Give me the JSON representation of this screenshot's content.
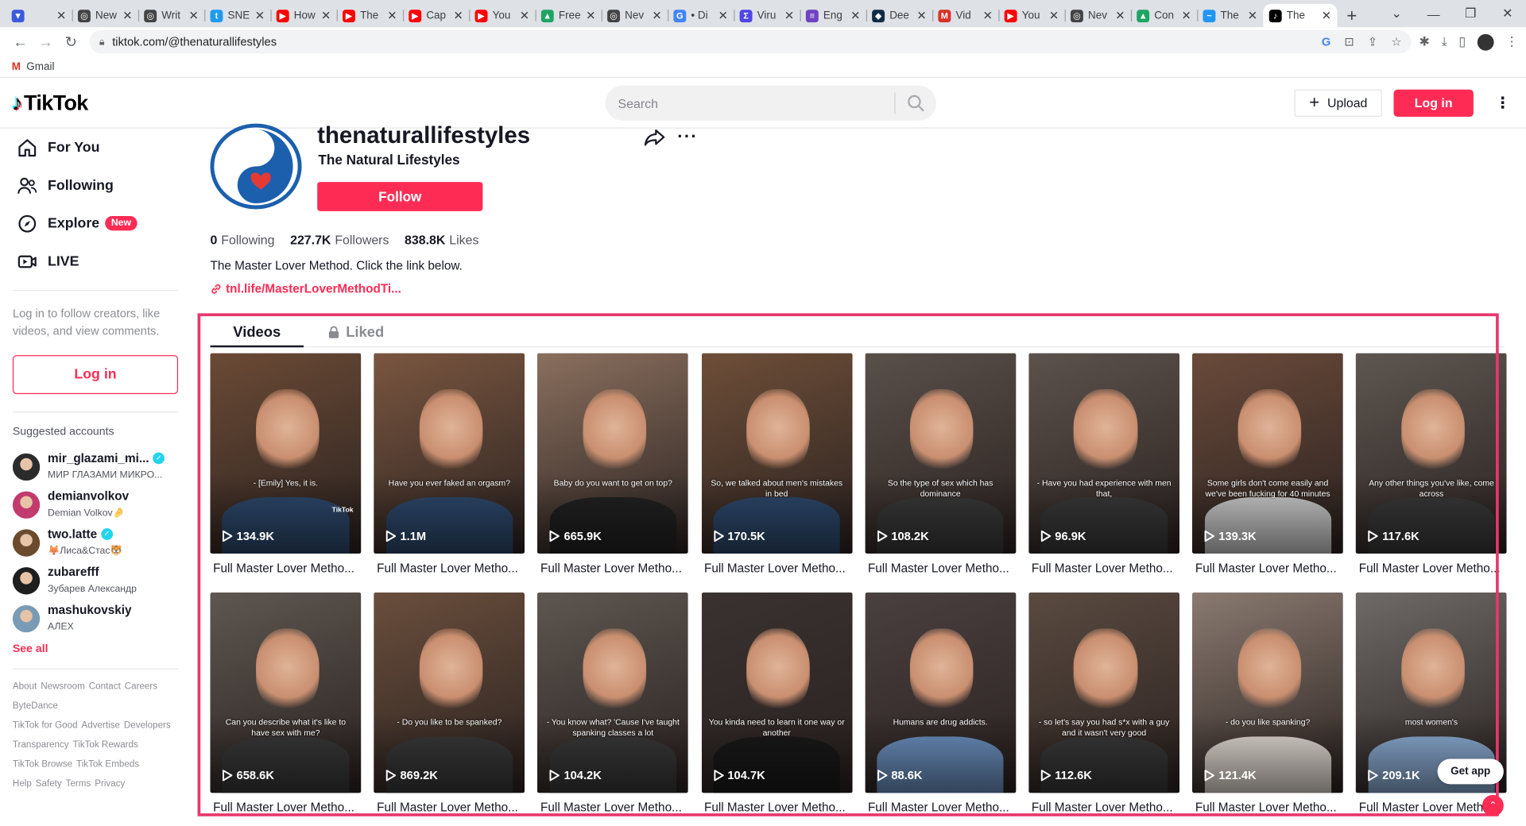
{
  "browser": {
    "tabs": [
      {
        "label": "",
        "icon": "vee-icon",
        "color": "#3b5bdb",
        "glyph": "▼"
      },
      {
        "label": "New",
        "icon": "chatgpt-icon",
        "color": "#444",
        "glyph": "◎"
      },
      {
        "label": "Writ",
        "icon": "chatgpt-icon",
        "color": "#444",
        "glyph": "◎"
      },
      {
        "label": "SNE",
        "icon": "twitter-icon",
        "color": "#1d9bf0",
        "glyph": "t"
      },
      {
        "label": "How",
        "icon": "youtube-icon",
        "color": "#ff0000",
        "glyph": "▶"
      },
      {
        "label": "The",
        "icon": "youtube-icon",
        "color": "#ff0000",
        "glyph": "▶"
      },
      {
        "label": "Cap",
        "icon": "youtube-icon",
        "color": "#ff0000",
        "glyph": "▶"
      },
      {
        "label": "You",
        "icon": "youtube-icon",
        "color": "#ff0000",
        "glyph": "▶"
      },
      {
        "label": "Free",
        "icon": "drive-icon",
        "color": "#1fa463",
        "glyph": "▲"
      },
      {
        "label": "Nev",
        "icon": "chatgpt-icon",
        "color": "#444",
        "glyph": "◎"
      },
      {
        "label": "• Di",
        "icon": "google-icon",
        "color": "#4285f4",
        "glyph": "G"
      },
      {
        "label": "Viru",
        "icon": "sigma-icon",
        "color": "#5046e5",
        "glyph": "Σ"
      },
      {
        "label": "Eng",
        "icon": "docs-icon",
        "color": "#6f42c1",
        "glyph": "≡"
      },
      {
        "label": "Dee",
        "icon": "deepl-icon",
        "color": "#0f2b46",
        "glyph": "◆"
      },
      {
        "label": "Vid",
        "icon": "gmail-icon",
        "color": "#d93025",
        "glyph": "M"
      },
      {
        "label": "You",
        "icon": "youtube-icon",
        "color": "#ff0000",
        "glyph": "▶"
      },
      {
        "label": "Nev",
        "icon": "chatgpt-icon",
        "color": "#444",
        "glyph": "◎"
      },
      {
        "label": "Con",
        "icon": "drive-icon",
        "color": "#1fa463",
        "glyph": "▲"
      },
      {
        "label": "The",
        "icon": "bird-icon",
        "color": "#2196f3",
        "glyph": "~"
      },
      {
        "label": "The",
        "icon": "tiktok-icon",
        "color": "#000",
        "glyph": "♪",
        "active": true
      }
    ],
    "url": "tiktok.com/@thenaturallifestyles",
    "bookmark": "Gmail"
  },
  "header": {
    "logo": "TikTok",
    "search_placeholder": "Search",
    "upload": "Upload",
    "login": "Log in"
  },
  "sidebar": {
    "nav": [
      {
        "label": "For You",
        "icon": "home-icon"
      },
      {
        "label": "Following",
        "icon": "following-icon"
      },
      {
        "label": "Explore",
        "icon": "compass-icon",
        "badge": "New"
      },
      {
        "label": "LIVE",
        "icon": "live-icon"
      }
    ],
    "prompt": "Log in to follow creators, like videos, and view comments.",
    "login": "Log in",
    "suggested_title": "Suggested accounts",
    "accounts": [
      {
        "name": "mir_glazami_mi...",
        "sub": "МИР ГЛАЗАМИ МИКРО...",
        "verified": true,
        "color": "#2b2b2b"
      },
      {
        "name": "demianvolkov",
        "sub": "Demian Volkov🤌",
        "verified": false,
        "color": "#c23b6e"
      },
      {
        "name": "two.latte",
        "sub": "🦊Лиса&Стас🐯",
        "verified": true,
        "color": "#6b4a2e"
      },
      {
        "name": "zubarefff",
        "sub": "Зубарев Александр",
        "verified": false,
        "color": "#1e1e1e"
      },
      {
        "name": "mashukovskiy",
        "sub": "АЛЕХ",
        "verified": false,
        "color": "#7a9bb5"
      }
    ],
    "see_all": "See all",
    "footer": [
      [
        "About",
        "Newsroom",
        "Contact",
        "Careers"
      ],
      [
        "ByteDance"
      ],
      [
        "TikTok for Good",
        "Advertise",
        "Developers"
      ],
      [
        "Transparency",
        "TikTok Rewards"
      ],
      [
        "TikTok Browse",
        "TikTok Embeds"
      ],
      [
        "Help",
        "Safety",
        "Terms",
        "Privacy"
      ]
    ]
  },
  "profile": {
    "username": "thenaturallifestyles",
    "nickname": "The Natural Lifestyles",
    "follow": "Follow",
    "stats": [
      {
        "value": "0",
        "label": "Following"
      },
      {
        "value": "227.7K",
        "label": "Followers"
      },
      {
        "value": "838.8K",
        "label": "Likes"
      }
    ],
    "bio": "The Master Lover Method. Click the link below.",
    "link": "tnl.life/MasterLoverMethodTi...",
    "tabs": {
      "videos": "Videos",
      "liked": "Liked"
    }
  },
  "videos": [
    {
      "views": "134.9K",
      "caption": "- [Emily] Yes, it is.",
      "title": "Full Master Lover Metho...",
      "bg": "#6b4a35",
      "shirt": "#2e4a6e",
      "watermark": "TikTok"
    },
    {
      "views": "1.1M",
      "caption": "Have you ever faked an orgasm?",
      "title": "Full Master Lover Metho...",
      "bg": "#7a5640",
      "shirt": "#2e4a6e"
    },
    {
      "views": "665.9K",
      "caption": "Baby do you want to get on top?",
      "title": "Full Master Lover Metho...",
      "bg": "#8a6f5e",
      "shirt": "#222222"
    },
    {
      "views": "170.5K",
      "caption": "So, we talked about men's mistakes in bed",
      "title": "Full Master Lover Metho...",
      "bg": "#6e4e38",
      "shirt": "#2e4a6e"
    },
    {
      "views": "108.2K",
      "caption": "So the type of sex which has dominance",
      "title": "Full Master Lover Metho...",
      "bg": "#5a504a",
      "shirt": "#3a3a3a"
    },
    {
      "views": "96.9K",
      "caption": "- Have you had experience with men that,",
      "title": "Full Master Lover Metho...",
      "bg": "#5c524c",
      "shirt": "#3a3a3a"
    },
    {
      "views": "139.3K",
      "caption": "Some girls don't come easily and we've been fucking for 40 minutes",
      "title": "Full Master Lover Metho...",
      "bg": "#6a4a3a",
      "shirt": "#d0d0d0"
    },
    {
      "views": "117.6K",
      "caption": "Any other things you've like, come across",
      "title": "Full Master Lover Metho...",
      "bg": "#5e5650",
      "shirt": "#3a3a3a"
    },
    {
      "views": "658.6K",
      "caption": "Can you describe what it's like to have sex with me?",
      "title": "Full Master Lover Metho...",
      "bg": "#5e5650",
      "shirt": "#3a3a3a"
    },
    {
      "views": "869.2K",
      "caption": "- Do you like to be spanked?",
      "title": "Full Master Lover Metho...",
      "bg": "#6a4e3c",
      "shirt": "#3a3a3a"
    },
    {
      "views": "104.2K",
      "caption": "- You know what? 'Cause I've taught spanking classes a lot",
      "title": "Full Master Lover Metho...",
      "bg": "#5e5650",
      "shirt": "#3a3a3a"
    },
    {
      "views": "104.7K",
      "caption": "You kinda need to learn it one way or another",
      "title": "Full Master Lover Metho...",
      "bg": "#3a3230",
      "shirt": "#1a1a1a"
    },
    {
      "views": "88.6K",
      "caption": "Humans are drug addicts.",
      "title": "Full Master Lover Metho...",
      "bg": "#4a4040",
      "shirt": "#6e94c4"
    },
    {
      "views": "112.6K",
      "caption": "- so let's say you had s*x with a guy and it wasn't very good",
      "title": "Full Master Lover Metho...",
      "bg": "#5a4a40",
      "shirt": "#3a3a3a"
    },
    {
      "views": "121.4K",
      "caption": "- do you like spanking?",
      "title": "Full Master Lover Metho...",
      "bg": "#8a7a70",
      "shirt": "#e8e0d8"
    },
    {
      "views": "209.1K",
      "caption": "most women's",
      "title": "Full Master Lover Metho...",
      "bg": "#6e6a68",
      "shirt": "#8fb0d8"
    }
  ],
  "get_app": "Get app",
  "colors": {
    "accent": "#fe2c55",
    "highlight": "#e8376d"
  }
}
